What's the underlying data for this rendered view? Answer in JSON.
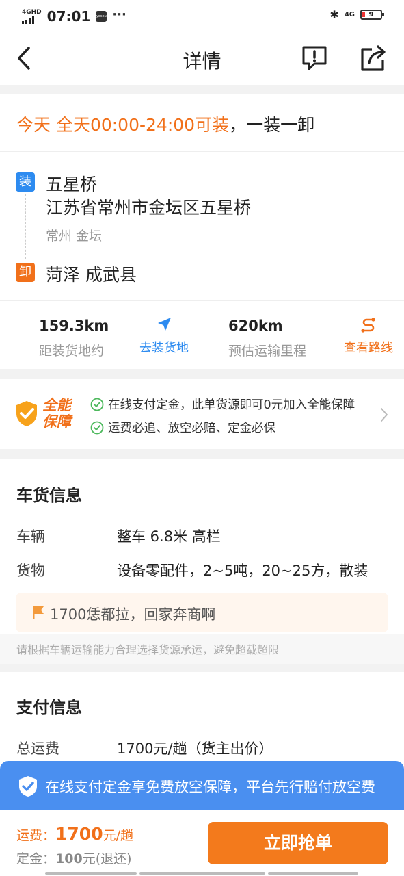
{
  "status_bar": {
    "network": "4GHD",
    "time": "07:01",
    "app_badge": "yoseu",
    "more": "···",
    "bluetooth": "✱",
    "signal_4g": "4G",
    "battery": "9"
  },
  "header": {
    "title": "详情"
  },
  "schedule": {
    "highlight": "今天 全天00:00-24:00可装",
    "rest": "，一装一卸"
  },
  "route": {
    "load_badge": "装",
    "load_name": "五星桥",
    "load_address": "江苏省常州市金坛区五星桥",
    "load_area": "常州 金坛",
    "unload_badge": "卸",
    "unload_name": "菏泽 成武县"
  },
  "stats": {
    "distance_value": "159.3km",
    "distance_label": "距装货地约",
    "navigate_label": "去装货地",
    "mileage_value": "620km",
    "mileage_label": "预估运输里程",
    "route_label": "查看路线"
  },
  "guarantee": {
    "logo_line1": "全能",
    "logo_line2": "保障",
    "item1": "在线支付定金，此单货源即可0元加入全能保障",
    "item2": "运费必追、放空必赔、定金必保"
  },
  "cargo": {
    "title": "车货信息",
    "vehicle_label": "车辆",
    "vehicle_value": "整车 6.8米 高栏",
    "goods_label": "货物",
    "goods_value": "设备零配件，2~5吨，20~25方，散装",
    "remark": "1700恁都拉，回家奔商啊",
    "tip": "请根据车辆运输能力合理选择货源承运，避免超载超限"
  },
  "payment": {
    "title": "支付信息",
    "total_label": "总运费",
    "total_value": "1700元/趟（货主出价）"
  },
  "banner": {
    "text": "在线支付定金享免费放空保障，平台先行赔付放空费"
  },
  "bottom": {
    "fee_label": "运费：",
    "fee_amount": "1700",
    "fee_unit": "元/趟",
    "deposit_label": "定金：",
    "deposit_amount": "100",
    "deposit_unit": "元(退还)",
    "grab_button": "立即抢单"
  },
  "colors": {
    "accent_orange": "#f1701a",
    "accent_blue": "#2d8bf0",
    "banner_blue": "#4a8ff0",
    "button_orange": "#f37a1c"
  }
}
